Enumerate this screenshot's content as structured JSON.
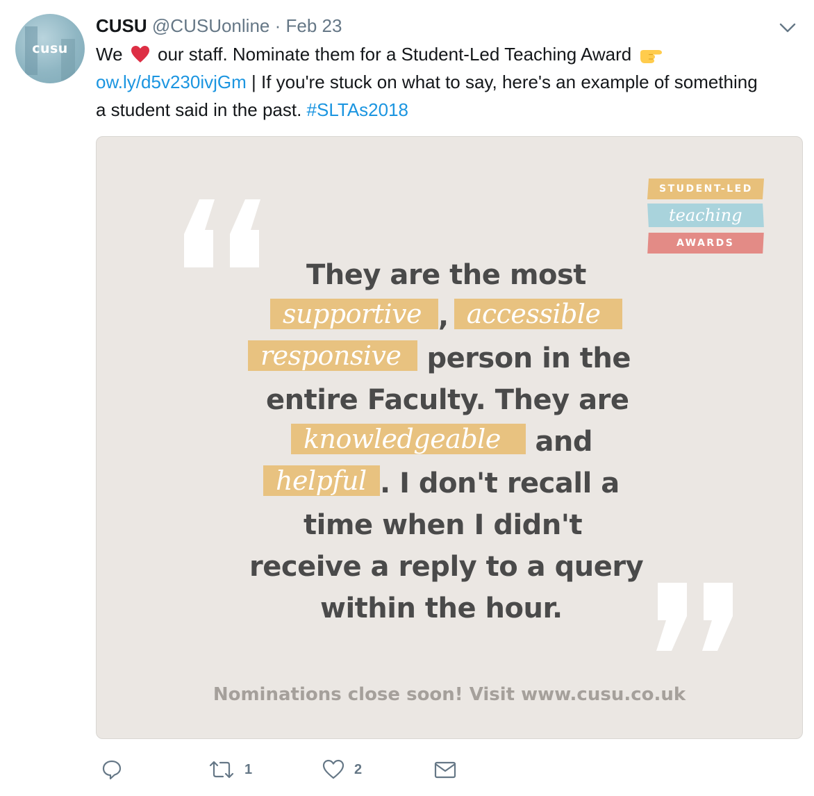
{
  "tweet": {
    "display_name": "CUSU",
    "handle": "@CUSUonline",
    "separator": "·",
    "date": "Feb 23",
    "avatar_text": "cusu",
    "text_part1": "We",
    "heart_emoji": "heart-emoji",
    "text_part2": "our staff. Nominate them for a Student-Led Teaching Award",
    "hand_emoji": "pointing-hand-emoji",
    "link": "ow.ly/d5v230ivjGm",
    "text_part3": "| If you're stuck on what to say, here's an example of something a student said in the past.",
    "hashtag": "#SLTAs2018"
  },
  "card": {
    "badge": {
      "line1": "STUDENT-LED",
      "line2": "teaching",
      "line3": "AWARDS"
    },
    "quote": {
      "l1": "They are the most",
      "hl1": "supportive",
      "comma": ",",
      "hl2": "accessible",
      "hl3": "responsive",
      "l3": "person in the",
      "l4": "entire Faculty. They are",
      "hl4": "knowledgeable",
      "l5": "and",
      "hl5": "helpful",
      "l6": ". I don't recall a",
      "l7": "time when I didn't",
      "l8": "receive a reply to a query",
      "l9": "within the hour."
    },
    "footer": "Nominations close soon! Visit www.cusu.co.uk"
  },
  "actions": {
    "reply_icon": "reply-icon",
    "retweet_icon": "retweet-icon",
    "retweet_count": "1",
    "like_icon": "heart-outline-icon",
    "like_count": "2",
    "dm_icon": "envelope-icon"
  },
  "colors": {
    "link": "#1b95e0",
    "secondary_text": "#657786",
    "card_background": "#ebe7e3",
    "highlight": "#e8c280",
    "quote_text": "#4a4a4a"
  }
}
